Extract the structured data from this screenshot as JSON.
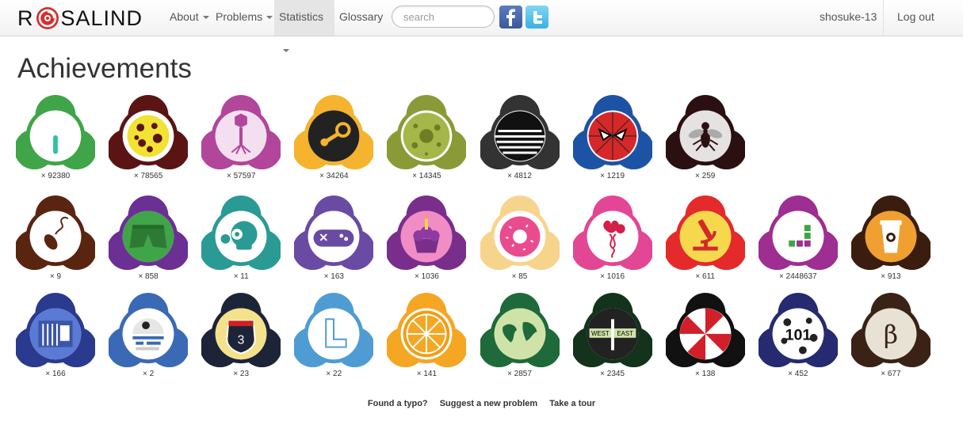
{
  "nav": {
    "brand_left": "R",
    "brand_right": "SALIND",
    "about": "About",
    "problems": "Problems",
    "statistics": "Statistics",
    "glossary": "Glossary",
    "search_placeholder": "search",
    "username": "shosuke-13",
    "logout": "Log out"
  },
  "page": {
    "title": "Achievements"
  },
  "badges": [
    {
      "icon": "seedling-in-tube-icon",
      "color": "#3fa548",
      "count": "× 92380"
    },
    {
      "icon": "petri-dish-icon",
      "color": "#5b1414",
      "count": "× 78565"
    },
    {
      "icon": "bacteriophage-icon",
      "color": "#b2469b",
      "count": "× 57597"
    },
    {
      "icon": "steam-logo-icon",
      "color": "#f6b32d",
      "count": "× 34264"
    },
    {
      "icon": "cell-icon",
      "color": "#8a9a36",
      "count": "× 14345"
    },
    {
      "icon": "striped-disk-icon",
      "color": "#333333",
      "count": "× 4812"
    },
    {
      "icon": "spider-man-mask-icon",
      "color": "#1c53a5",
      "count": "× 1219"
    },
    {
      "icon": "fly-icon",
      "color": "#2a1010",
      "count": "× 259"
    },
    {
      "icon": "computer-mouse-icon",
      "color": "#5a2510",
      "count": "× 9"
    },
    {
      "icon": "shorts-icon",
      "color": "#6c2f94",
      "count": "× 858"
    },
    {
      "icon": "skull-icon",
      "color": "#2a9a94",
      "count": "× 11"
    },
    {
      "icon": "gamepad-icon",
      "color": "#6a4ba3",
      "count": "× 163"
    },
    {
      "icon": "cupcake-icon",
      "color": "#7a2e8c",
      "count": "× 1036"
    },
    {
      "icon": "donut-icon",
      "color": "#f7d48c",
      "count": "× 85"
    },
    {
      "icon": "balloons-dna-icon",
      "color": "#e24694",
      "count": "× 1016"
    },
    {
      "icon": "microscope-icon",
      "color": "#e42a2a",
      "count": "× 611"
    },
    {
      "icon": "tetris-blocks-icon",
      "color": "#9e2e91",
      "count": "× 2448637"
    },
    {
      "icon": "coffee-cup-icon",
      "color": "#3a1d0e",
      "count": "× 913"
    },
    {
      "icon": "bookshelf-icon",
      "color": "#2a3a8f",
      "count": "× 166"
    },
    {
      "icon": "r2d2-icon",
      "color": "#3a6ab5",
      "count": "× 2"
    },
    {
      "icon": "highway-shield-icon",
      "color": "#1d2438",
      "count": "× 23"
    },
    {
      "icon": "tetromino-outline-icon",
      "color": "#4f9cd4",
      "count": "× 22"
    },
    {
      "icon": "orange-slice-icon",
      "color": "#f5a623",
      "count": "× 141"
    },
    {
      "icon": "world-map-icon",
      "color": "#1e6a3a",
      "count": "× 2857"
    },
    {
      "icon": "west-east-sign-icon",
      "color": "#13331c",
      "count": "× 2345"
    },
    {
      "icon": "umbrella-icon",
      "color": "#111111",
      "count": "× 138"
    },
    {
      "icon": "dalmatian-101-icon",
      "color": "#262a70",
      "count": "× 452"
    },
    {
      "icon": "beta-icon",
      "color": "#3a2216",
      "count": "× 677"
    }
  ],
  "badge_symbols": {
    "highway": "3",
    "west": "WEST",
    "east": "EAST",
    "dalmatian": "101",
    "beta": "β"
  },
  "footer": {
    "typo": "Found a typo?",
    "suggest": "Suggest a new problem",
    "tour": "Take a tour"
  }
}
